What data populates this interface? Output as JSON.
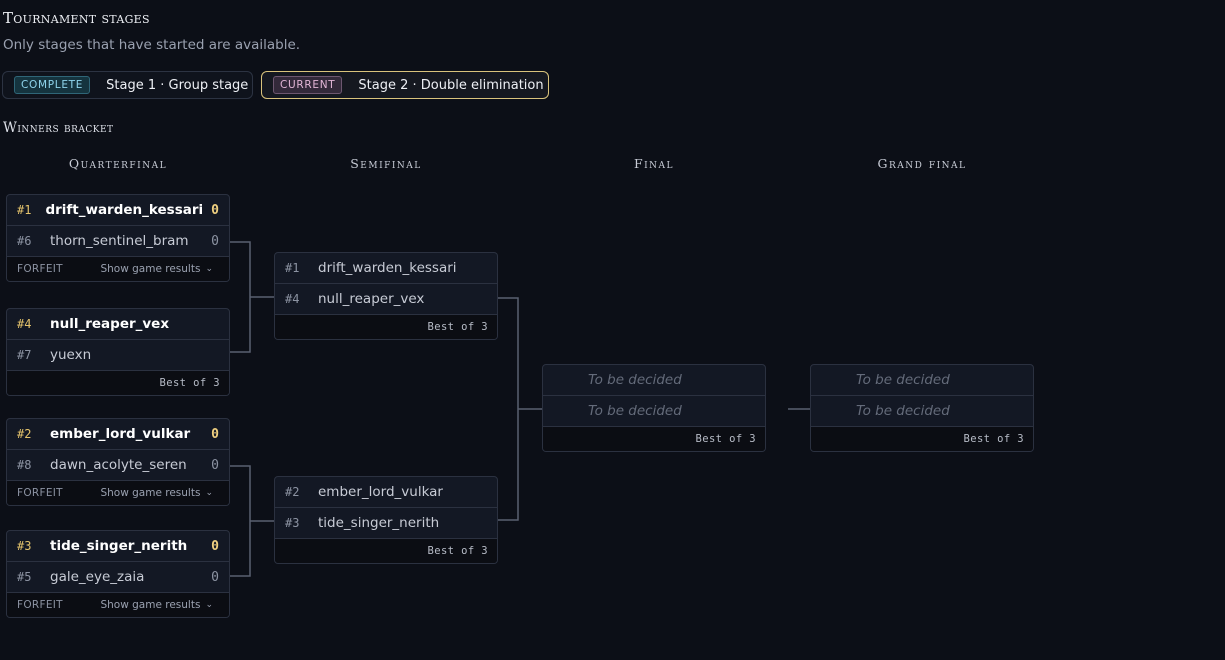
{
  "header": {
    "title": "Tournament stages",
    "subtitle": "Only stages that have started are available."
  },
  "stages": [
    {
      "badge": "COMPLETE",
      "label": "Stage 1 · Group stage"
    },
    {
      "badge": "CURRENT",
      "label": "Stage 2 · Double elimination"
    }
  ],
  "bracket": {
    "title": "Winners bracket",
    "rounds": [
      "Quarterfinal",
      "Semifinal",
      "Final",
      "Grand final"
    ],
    "quarterfinals": [
      {
        "p1": {
          "seed": "#1",
          "name": "drift_warden_kessari",
          "score": "0"
        },
        "p2": {
          "seed": "#6",
          "name": "thorn_sentinel_bram",
          "score": "0"
        },
        "forfeit": "FORFEIT",
        "results": "Show game results"
      },
      {
        "p1": {
          "seed": "#4",
          "name": "null_reaper_vex"
        },
        "p2": {
          "seed": "#7",
          "name": "yuexn"
        },
        "best_of": "Best of 3"
      },
      {
        "p1": {
          "seed": "#2",
          "name": "ember_lord_vulkar",
          "score": "0"
        },
        "p2": {
          "seed": "#8",
          "name": "dawn_acolyte_seren",
          "score": "0"
        },
        "forfeit": "FORFEIT",
        "results": "Show game results"
      },
      {
        "p1": {
          "seed": "#3",
          "name": "tide_singer_nerith",
          "score": "0"
        },
        "p2": {
          "seed": "#5",
          "name": "gale_eye_zaia",
          "score": "0"
        },
        "forfeit": "FORFEIT",
        "results": "Show game results"
      }
    ],
    "semifinals": [
      {
        "p1": {
          "seed": "#1",
          "name": "drift_warden_kessari"
        },
        "p2": {
          "seed": "#4",
          "name": "null_reaper_vex"
        },
        "best_of": "Best of 3"
      },
      {
        "p1": {
          "seed": "#2",
          "name": "ember_lord_vulkar"
        },
        "p2": {
          "seed": "#3",
          "name": "tide_singer_nerith"
        },
        "best_of": "Best of 3"
      }
    ],
    "final": {
      "p1": {
        "name": "To be decided"
      },
      "p2": {
        "name": "To be decided"
      },
      "best_of": "Best of 3"
    },
    "grand_final": {
      "p1": {
        "name": "To be decided"
      },
      "p2": {
        "name": "To be decided"
      },
      "best_of": "Best of 3"
    }
  },
  "colors": {
    "background": "#0c0f17",
    "card": "#131824",
    "border": "#2b3140",
    "winner_score": "#f0d080",
    "current_border": "#d9c37c",
    "complete_badge": "#8fd4ec"
  }
}
